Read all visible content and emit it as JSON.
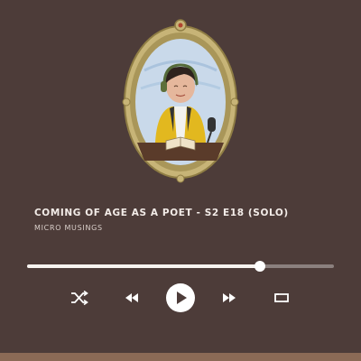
{
  "track": {
    "title": "COMING OF AGE AS A POET - S2 E18 (SOLO)",
    "artist": "MICRO MUSINGS"
  },
  "player": {
    "progress_fraction": 0.76,
    "controls": [
      "shuffle-icon",
      "previous-icon",
      "play-icon",
      "next-icon",
      "repeat-icon"
    ]
  },
  "colors": {
    "background": "#4d3c39",
    "text": "#f3ece8",
    "frame": "#c8b67a",
    "accent_bar": "#8b6a56"
  }
}
